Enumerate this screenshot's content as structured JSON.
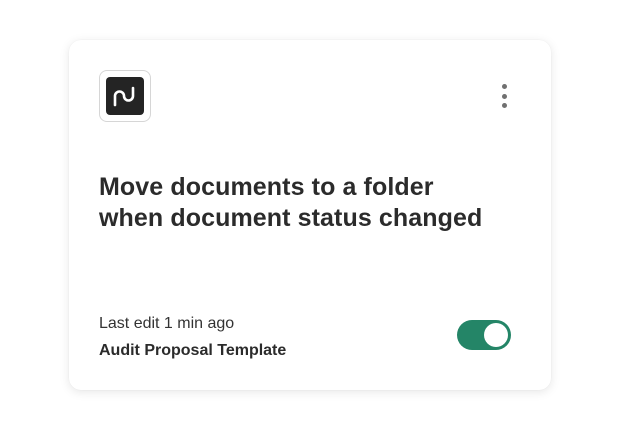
{
  "card": {
    "logo_icon": "pandadoc-logo-icon",
    "menu_icon": "more-vertical-icon",
    "title": "Move documents to a folder when document status changed",
    "last_edit": "Last edit 1 min ago",
    "template_name": "Audit Proposal Template",
    "toggle": {
      "enabled": true,
      "color_on": "#248567"
    }
  },
  "colors": {
    "logo_background": "#242424",
    "title_text": "#2b2b2b",
    "menu_dots": "#707070"
  }
}
